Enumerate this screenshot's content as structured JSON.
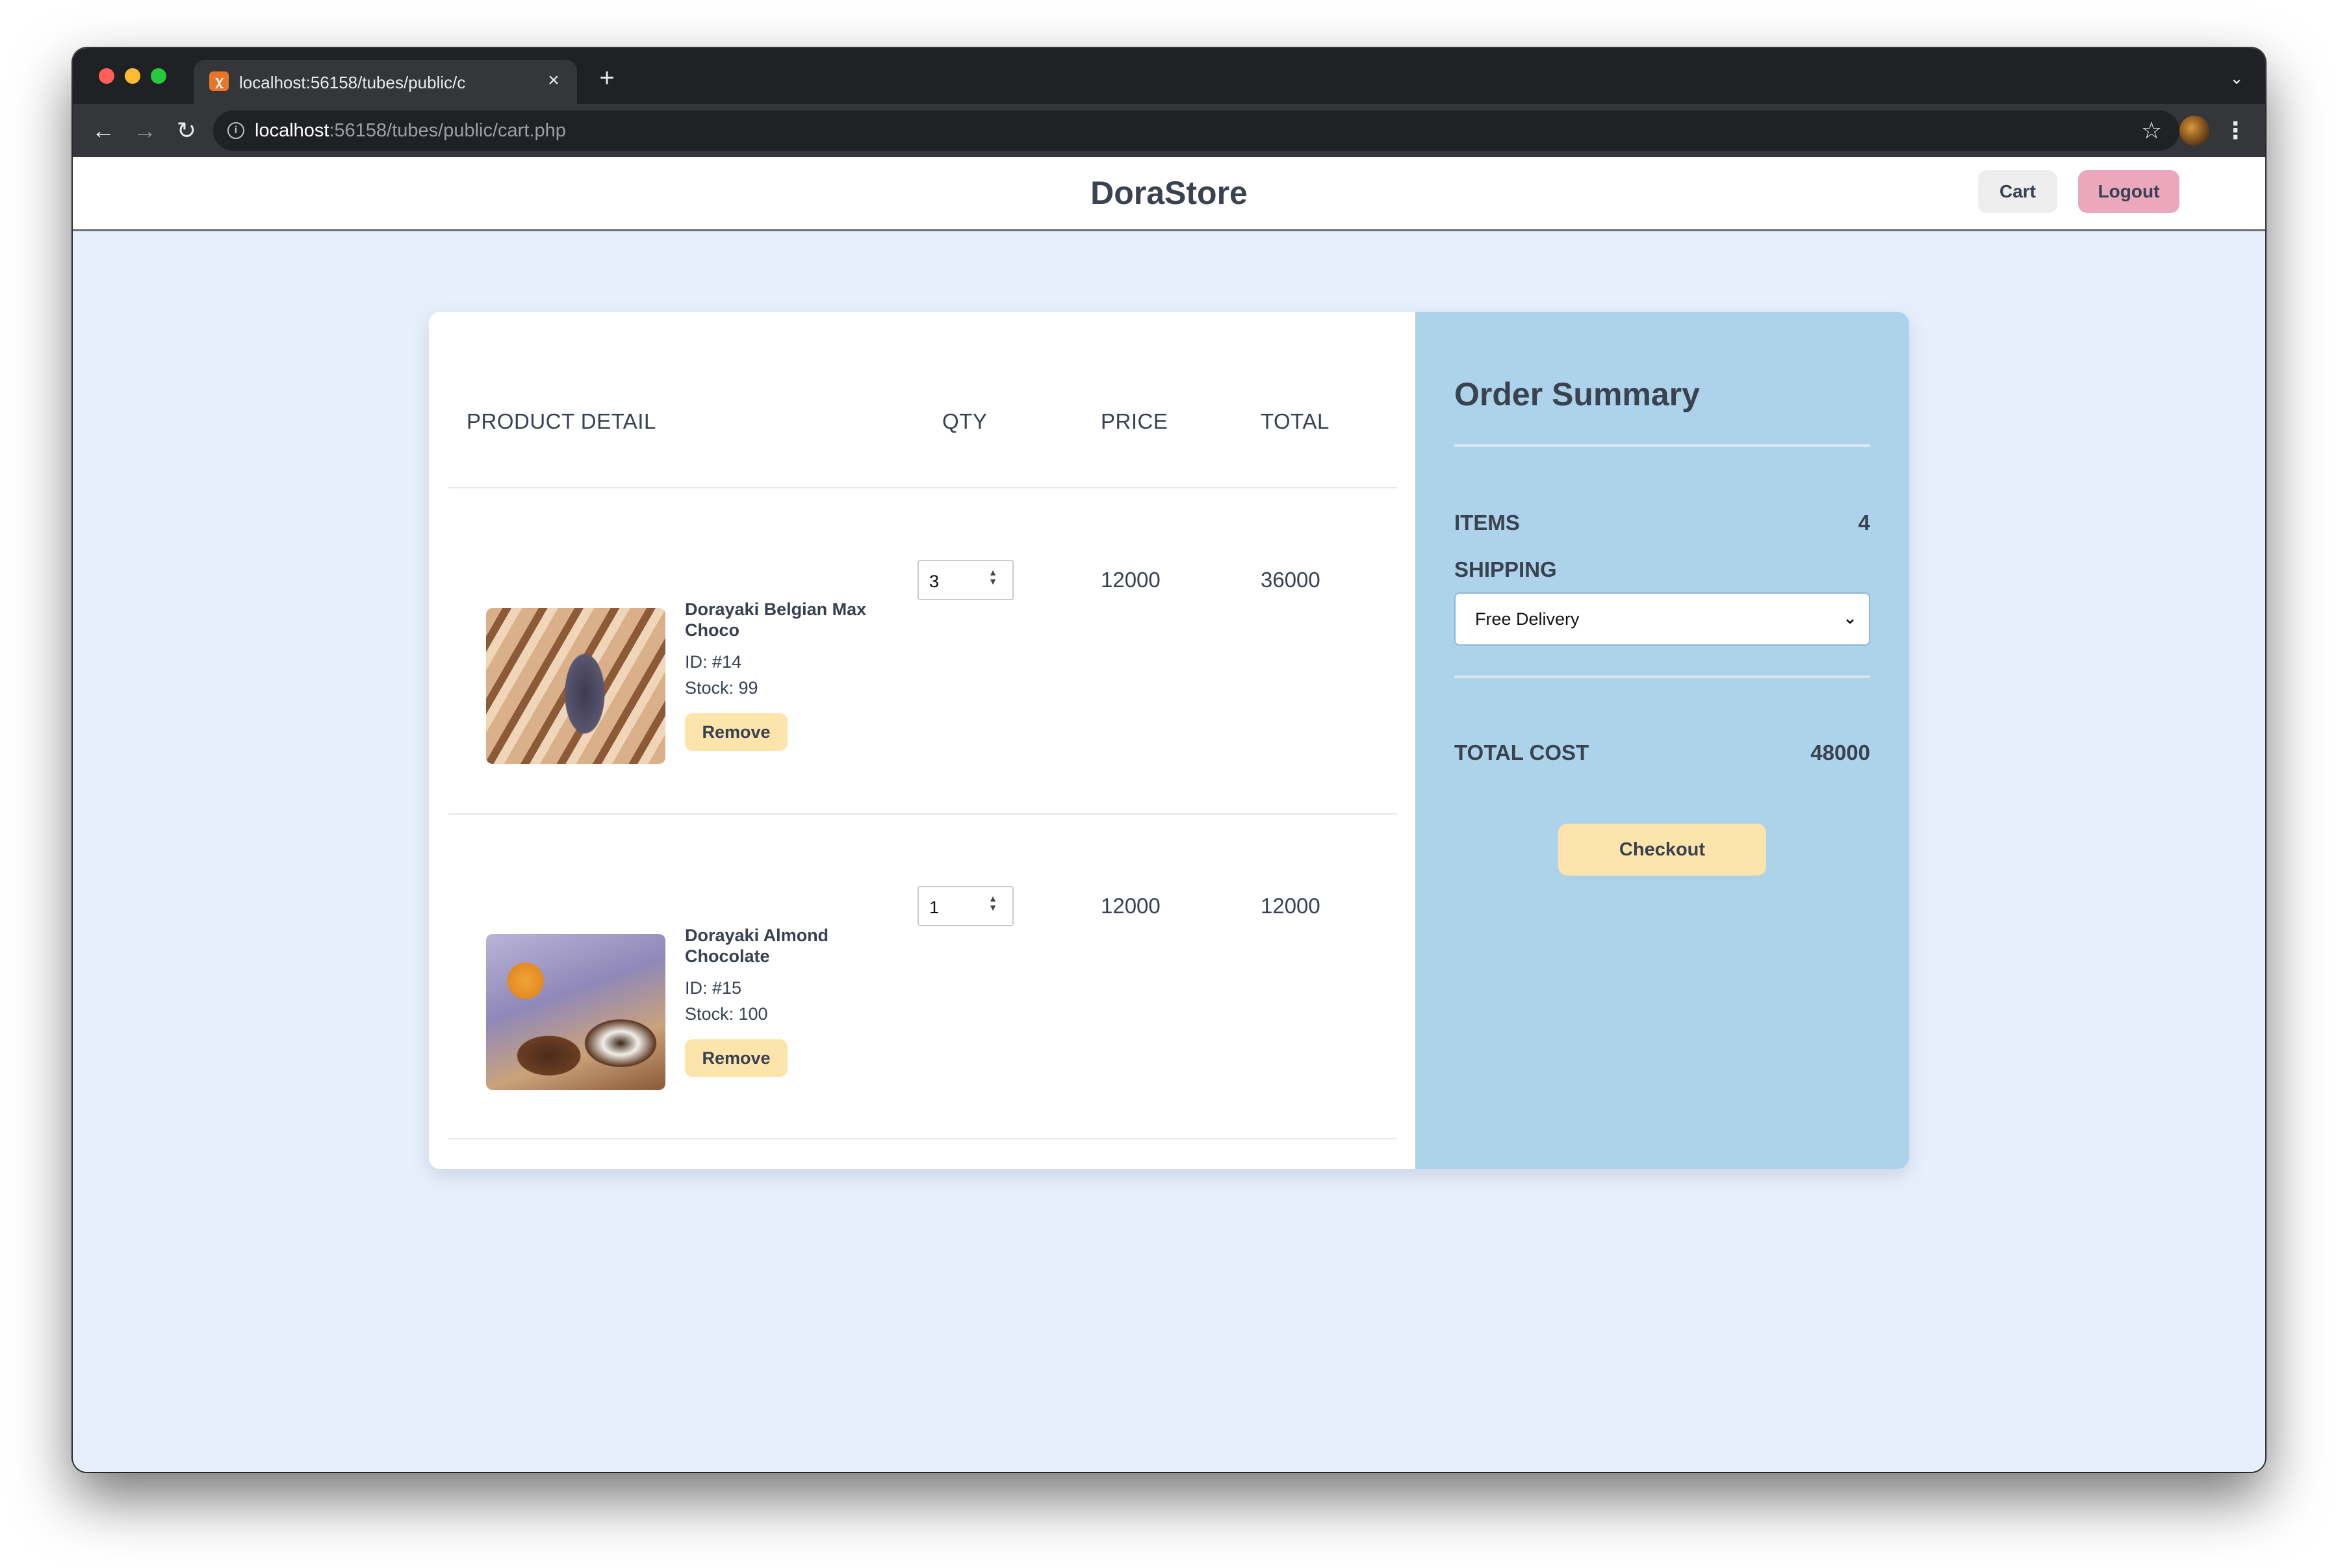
{
  "browser": {
    "tab_title": "localhost:56158/tubes/public/c",
    "tab_close": "×",
    "new_tab": "+",
    "url_host": "localhost",
    "url_rest": ":56158/tubes/public/cart.php",
    "icons": {
      "back": "arrow-left-icon",
      "forward": "arrow-right-icon",
      "reload": "reload-icon",
      "info": "info-icon",
      "star": "star-icon",
      "menu": "kebab-menu-icon"
    }
  },
  "header": {
    "brand": "DoraStore",
    "cart_label": "Cart",
    "logout_label": "Logout"
  },
  "cart": {
    "columns": [
      "PRODUCT DETAIL",
      "QTY",
      "PRICE",
      "TOTAL"
    ],
    "items": [
      {
        "name": "Dorayaki Belgian Max Choco",
        "id": "ID: #14",
        "stock": "Stock: 99",
        "qty": "3",
        "price": "12000",
        "total": "36000",
        "remove_label": "Remove"
      },
      {
        "name": "Dorayaki Almond Chocolate",
        "id": "ID: #15",
        "stock": "Stock: 100",
        "qty": "1",
        "price": "12000",
        "total": "12000",
        "remove_label": "Remove"
      }
    ]
  },
  "summary": {
    "title": "Order Summary",
    "items_label": "ITEMS",
    "items_value": "4",
    "shipping_label": "SHIPPING",
    "shipping_selected": "Free Delivery",
    "total_label": "TOTAL COST",
    "total_value": "48000",
    "checkout_label": "Checkout"
  },
  "colors": {
    "page_bg": "#e8effc",
    "summary_bg": "#acd3ea",
    "accent_yellow": "#fde4ab",
    "logout_pink": "#eba7bb",
    "text_dark": "#374151"
  }
}
